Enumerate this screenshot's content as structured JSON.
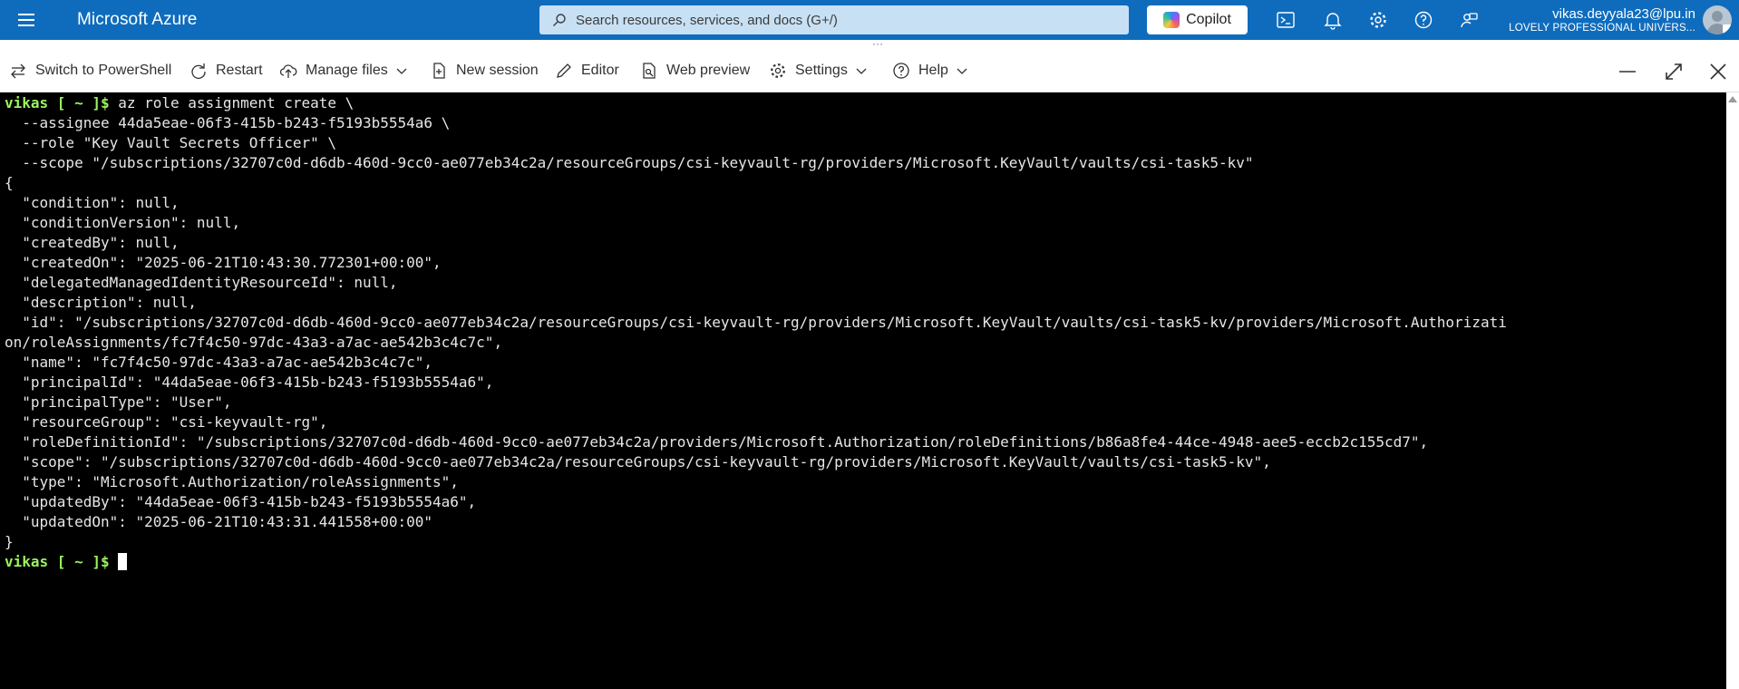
{
  "topbar": {
    "brand": "Microsoft Azure",
    "search_placeholder": "Search resources, services, and docs (G+/)",
    "copilot_label": "Copilot",
    "account_email": "vikas.deyyala23@lpu.in",
    "account_org": "LOVELY PROFESSIONAL UNIVERS...",
    "icons": [
      "menu-icon",
      "cloud-shell-icon",
      "notifications-icon",
      "settings-icon",
      "help-icon",
      "feedback-icon"
    ]
  },
  "toolbar": {
    "switch_label": "Switch to PowerShell",
    "restart_label": "Restart",
    "manage_files_label": "Manage files",
    "new_session_label": "New session",
    "editor_label": "Editor",
    "web_preview_label": "Web preview",
    "settings_label": "Settings",
    "help_label": "Help"
  },
  "terminal": {
    "prompt": "vikas [ ~ ]$",
    "lines": [
      {
        "prompt": "vikas [ ~ ]$",
        "text": " az role assignment create \\"
      },
      {
        "text": "  --assignee 44da5eae-06f3-415b-b243-f5193b5554a6 \\"
      },
      {
        "text": "  --role \"Key Vault Secrets Officer\" \\"
      },
      {
        "text": "  --scope \"/subscriptions/32707c0d-d6db-460d-9cc0-ae077eb34c2a/resourceGroups/csi-keyvault-rg/providers/Microsoft.KeyVault/vaults/csi-task5-kv\""
      },
      {
        "text": "{"
      },
      {
        "text": "  \"condition\": null,"
      },
      {
        "text": "  \"conditionVersion\": null,"
      },
      {
        "text": "  \"createdBy\": null,"
      },
      {
        "text": "  \"createdOn\": \"2025-06-21T10:43:30.772301+00:00\","
      },
      {
        "text": "  \"delegatedManagedIdentityResourceId\": null,"
      },
      {
        "text": "  \"description\": null,"
      },
      {
        "text": "  \"id\": \"/subscriptions/32707c0d-d6db-460d-9cc0-ae077eb34c2a/resourceGroups/csi-keyvault-rg/providers/Microsoft.KeyVault/vaults/csi-task5-kv/providers/Microsoft.Authorizati"
      },
      {
        "text": "on/roleAssignments/fc7f4c50-97dc-43a3-a7ac-ae542b3c4c7c\","
      },
      {
        "text": "  \"name\": \"fc7f4c50-97dc-43a3-a7ac-ae542b3c4c7c\","
      },
      {
        "text": "  \"principalId\": \"44da5eae-06f3-415b-b243-f5193b5554a6\","
      },
      {
        "text": "  \"principalType\": \"User\","
      },
      {
        "text": "  \"resourceGroup\": \"csi-keyvault-rg\","
      },
      {
        "text": "  \"roleDefinitionId\": \"/subscriptions/32707c0d-d6db-460d-9cc0-ae077eb34c2a/providers/Microsoft.Authorization/roleDefinitions/b86a8fe4-44ce-4948-aee5-eccb2c155cd7\","
      },
      {
        "text": "  \"scope\": \"/subscriptions/32707c0d-d6db-460d-9cc0-ae077eb34c2a/resourceGroups/csi-keyvault-rg/providers/Microsoft.KeyVault/vaults/csi-task5-kv\","
      },
      {
        "text": "  \"type\": \"Microsoft.Authorization/roleAssignments\","
      },
      {
        "text": "  \"updatedBy\": \"44da5eae-06f3-415b-b243-f5193b5554a6\","
      },
      {
        "text": "  \"updatedOn\": \"2025-06-21T10:43:31.441558+00:00\""
      },
      {
        "text": "}"
      },
      {
        "prompt": "vikas [ ~ ]$",
        "text": " ",
        "cursor": true
      }
    ]
  },
  "colors": {
    "topbar": "#0f6cbd",
    "prompt": "#9bf35f",
    "terminal_bg": "#000000",
    "terminal_fg": "#e6e6e6"
  }
}
